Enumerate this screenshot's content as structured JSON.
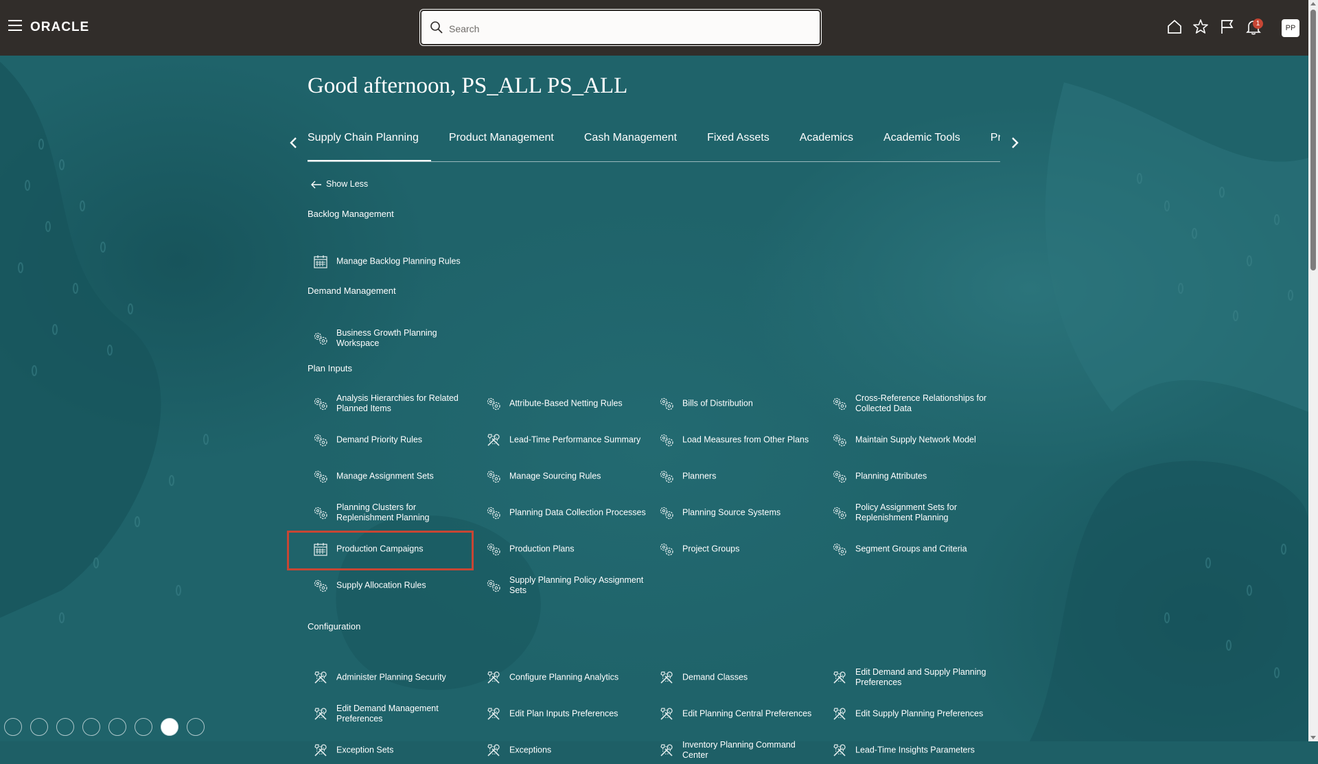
{
  "app": {
    "brand": "ORACLE"
  },
  "topbar": {
    "search_placeholder": "Search",
    "notification_count": "1",
    "avatar_initials": "PP"
  },
  "greeting": "Good afternoon, PS_ALL PS_ALL",
  "tabs": [
    {
      "label": "Supply Chain Planning",
      "active": true
    },
    {
      "label": "Product Management"
    },
    {
      "label": "Cash Management"
    },
    {
      "label": "Fixed Assets"
    },
    {
      "label": "Academics"
    },
    {
      "label": "Academic Tools"
    },
    {
      "label": "Procurement"
    }
  ],
  "show_less_label": "Show Less",
  "sections": {
    "backlog": {
      "title": "Backlog Management",
      "items": [
        {
          "label": "Manage Backlog Planning Rules",
          "icon": "calendar-icon"
        }
      ]
    },
    "demand": {
      "title": "Demand Management",
      "items": [
        {
          "label": "Business Growth Planning Workspace",
          "icon": "gears-icon"
        }
      ]
    },
    "plan_inputs": {
      "title": "Plan Inputs",
      "items": [
        {
          "label": "Analysis Hierarchies for Related Planned Items",
          "icon": "gears-icon"
        },
        {
          "label": "Attribute-Based Netting Rules",
          "icon": "gears-icon"
        },
        {
          "label": "Bills of Distribution",
          "icon": "gears-icon"
        },
        {
          "label": "Cross-Reference Relationships for Collected Data",
          "icon": "gears-icon"
        },
        {
          "label": "Demand Priority Rules",
          "icon": "gears-icon"
        },
        {
          "label": "Lead-Time Performance Summary",
          "icon": "tools-icon"
        },
        {
          "label": "Load Measures from Other Plans",
          "icon": "gears-icon"
        },
        {
          "label": "Maintain Supply Network Model",
          "icon": "gears-icon"
        },
        {
          "label": "Manage Assignment Sets",
          "icon": "gears-icon"
        },
        {
          "label": "Manage Sourcing Rules",
          "icon": "gears-icon"
        },
        {
          "label": "Planners",
          "icon": "gears-icon"
        },
        {
          "label": "Planning Attributes",
          "icon": "gears-icon"
        },
        {
          "label": "Planning Clusters for Replenishment Planning",
          "icon": "gears-icon"
        },
        {
          "label": "Planning Data Collection Processes",
          "icon": "gears-icon"
        },
        {
          "label": "Planning Source Systems",
          "icon": "gears-icon"
        },
        {
          "label": "Policy Assignment Sets for Replenishment Planning",
          "icon": "gears-icon"
        },
        {
          "label": "Production Campaigns",
          "icon": "calendar-icon"
        },
        {
          "label": "Production Plans",
          "icon": "gears-icon"
        },
        {
          "label": "Project Groups",
          "icon": "gears-icon"
        },
        {
          "label": "Segment Groups and Criteria",
          "icon": "gears-icon"
        },
        {
          "label": "Supply Allocation Rules",
          "icon": "gears-icon"
        },
        {
          "label": "Supply Planning Policy Assignment Sets",
          "icon": "gears-icon"
        }
      ]
    },
    "configuration": {
      "title": "Configuration",
      "items": [
        {
          "label": "Administer Planning Security",
          "icon": "tools-icon"
        },
        {
          "label": "Configure Planning Analytics",
          "icon": "tools-icon"
        },
        {
          "label": "Demand Classes",
          "icon": "tools-icon"
        },
        {
          "label": "Edit Demand and Supply Planning Preferences",
          "icon": "tools-icon"
        },
        {
          "label": "Edit Demand Management Preferences",
          "icon": "tools-icon"
        },
        {
          "label": "Edit Plan Inputs Preferences",
          "icon": "tools-icon"
        },
        {
          "label": "Edit Planning Central Preferences",
          "icon": "tools-icon"
        },
        {
          "label": "Edit Supply Planning Preferences",
          "icon": "tools-icon"
        },
        {
          "label": "Exception Sets",
          "icon": "tools-icon"
        },
        {
          "label": "Exceptions",
          "icon": "tools-icon"
        },
        {
          "label": "Inventory Planning Command Center",
          "icon": "tools-icon"
        },
        {
          "label": "Lead-Time Insights Parameters",
          "icon": "tools-icon"
        }
      ]
    }
  },
  "highlighted_item": "Production Campaigns",
  "colors": {
    "topbar": "#312d2a",
    "background": "#1f636a",
    "highlight": "#c74634",
    "badge": "#c74634"
  }
}
